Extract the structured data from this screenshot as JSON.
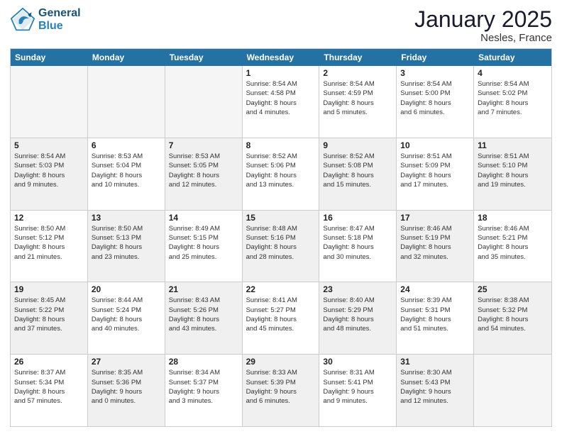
{
  "header": {
    "logo_line1": "General",
    "logo_line2": "Blue",
    "title": "January 2025",
    "subtitle": "Nesles, France"
  },
  "days_of_week": [
    "Sunday",
    "Monday",
    "Tuesday",
    "Wednesday",
    "Thursday",
    "Friday",
    "Saturday"
  ],
  "rows": [
    [
      {
        "day": "",
        "info": "",
        "empty": true
      },
      {
        "day": "",
        "info": "",
        "empty": true
      },
      {
        "day": "",
        "info": "",
        "empty": true
      },
      {
        "day": "1",
        "info": "Sunrise: 8:54 AM\nSunset: 4:58 PM\nDaylight: 8 hours\nand 4 minutes."
      },
      {
        "day": "2",
        "info": "Sunrise: 8:54 AM\nSunset: 4:59 PM\nDaylight: 8 hours\nand 5 minutes."
      },
      {
        "day": "3",
        "info": "Sunrise: 8:54 AM\nSunset: 5:00 PM\nDaylight: 8 hours\nand 6 minutes."
      },
      {
        "day": "4",
        "info": "Sunrise: 8:54 AM\nSunset: 5:02 PM\nDaylight: 8 hours\nand 7 minutes."
      }
    ],
    [
      {
        "day": "5",
        "info": "Sunrise: 8:54 AM\nSunset: 5:03 PM\nDaylight: 8 hours\nand 9 minutes.",
        "shaded": true
      },
      {
        "day": "6",
        "info": "Sunrise: 8:53 AM\nSunset: 5:04 PM\nDaylight: 8 hours\nand 10 minutes."
      },
      {
        "day": "7",
        "info": "Sunrise: 8:53 AM\nSunset: 5:05 PM\nDaylight: 8 hours\nand 12 minutes.",
        "shaded": true
      },
      {
        "day": "8",
        "info": "Sunrise: 8:52 AM\nSunset: 5:06 PM\nDaylight: 8 hours\nand 13 minutes."
      },
      {
        "day": "9",
        "info": "Sunrise: 8:52 AM\nSunset: 5:08 PM\nDaylight: 8 hours\nand 15 minutes.",
        "shaded": true
      },
      {
        "day": "10",
        "info": "Sunrise: 8:51 AM\nSunset: 5:09 PM\nDaylight: 8 hours\nand 17 minutes."
      },
      {
        "day": "11",
        "info": "Sunrise: 8:51 AM\nSunset: 5:10 PM\nDaylight: 8 hours\nand 19 minutes.",
        "shaded": true
      }
    ],
    [
      {
        "day": "12",
        "info": "Sunrise: 8:50 AM\nSunset: 5:12 PM\nDaylight: 8 hours\nand 21 minutes."
      },
      {
        "day": "13",
        "info": "Sunrise: 8:50 AM\nSunset: 5:13 PM\nDaylight: 8 hours\nand 23 minutes.",
        "shaded": true
      },
      {
        "day": "14",
        "info": "Sunrise: 8:49 AM\nSunset: 5:15 PM\nDaylight: 8 hours\nand 25 minutes."
      },
      {
        "day": "15",
        "info": "Sunrise: 8:48 AM\nSunset: 5:16 PM\nDaylight: 8 hours\nand 28 minutes.",
        "shaded": true
      },
      {
        "day": "16",
        "info": "Sunrise: 8:47 AM\nSunset: 5:18 PM\nDaylight: 8 hours\nand 30 minutes."
      },
      {
        "day": "17",
        "info": "Sunrise: 8:46 AM\nSunset: 5:19 PM\nDaylight: 8 hours\nand 32 minutes.",
        "shaded": true
      },
      {
        "day": "18",
        "info": "Sunrise: 8:46 AM\nSunset: 5:21 PM\nDaylight: 8 hours\nand 35 minutes."
      }
    ],
    [
      {
        "day": "19",
        "info": "Sunrise: 8:45 AM\nSunset: 5:22 PM\nDaylight: 8 hours\nand 37 minutes.",
        "shaded": true
      },
      {
        "day": "20",
        "info": "Sunrise: 8:44 AM\nSunset: 5:24 PM\nDaylight: 8 hours\nand 40 minutes."
      },
      {
        "day": "21",
        "info": "Sunrise: 8:43 AM\nSunset: 5:26 PM\nDaylight: 8 hours\nand 43 minutes.",
        "shaded": true
      },
      {
        "day": "22",
        "info": "Sunrise: 8:41 AM\nSunset: 5:27 PM\nDaylight: 8 hours\nand 45 minutes."
      },
      {
        "day": "23",
        "info": "Sunrise: 8:40 AM\nSunset: 5:29 PM\nDaylight: 8 hours\nand 48 minutes.",
        "shaded": true
      },
      {
        "day": "24",
        "info": "Sunrise: 8:39 AM\nSunset: 5:31 PM\nDaylight: 8 hours\nand 51 minutes."
      },
      {
        "day": "25",
        "info": "Sunrise: 8:38 AM\nSunset: 5:32 PM\nDaylight: 8 hours\nand 54 minutes.",
        "shaded": true
      }
    ],
    [
      {
        "day": "26",
        "info": "Sunrise: 8:37 AM\nSunset: 5:34 PM\nDaylight: 8 hours\nand 57 minutes."
      },
      {
        "day": "27",
        "info": "Sunrise: 8:35 AM\nSunset: 5:36 PM\nDaylight: 9 hours\nand 0 minutes.",
        "shaded": true
      },
      {
        "day": "28",
        "info": "Sunrise: 8:34 AM\nSunset: 5:37 PM\nDaylight: 9 hours\nand 3 minutes."
      },
      {
        "day": "29",
        "info": "Sunrise: 8:33 AM\nSunset: 5:39 PM\nDaylight: 9 hours\nand 6 minutes.",
        "shaded": true
      },
      {
        "day": "30",
        "info": "Sunrise: 8:31 AM\nSunset: 5:41 PM\nDaylight: 9 hours\nand 9 minutes."
      },
      {
        "day": "31",
        "info": "Sunrise: 8:30 AM\nSunset: 5:43 PM\nDaylight: 9 hours\nand 12 minutes.",
        "shaded": true
      },
      {
        "day": "",
        "info": "",
        "empty": true
      }
    ]
  ]
}
